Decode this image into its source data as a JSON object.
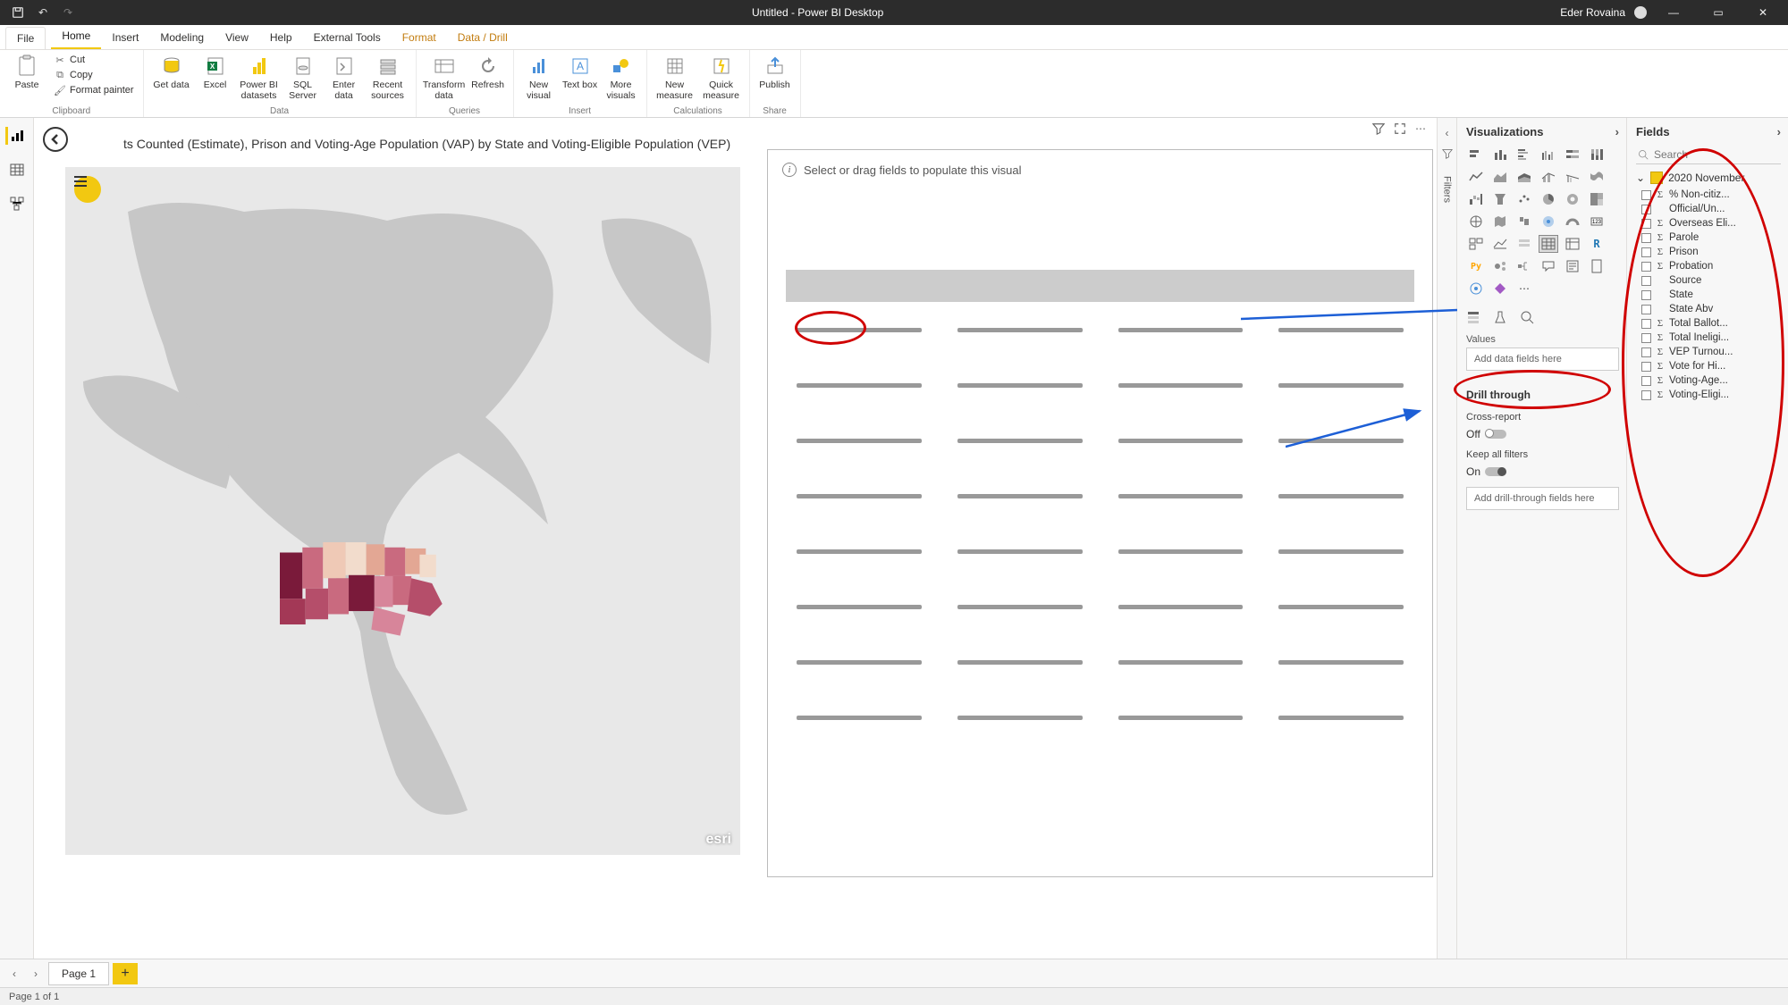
{
  "titlebar": {
    "title": "Untitled - Power BI Desktop",
    "user": "Eder Rovaina"
  },
  "tabs": {
    "file": "File",
    "items": [
      "Home",
      "Insert",
      "Modeling",
      "View",
      "Help",
      "External Tools",
      "Format",
      "Data / Drill"
    ],
    "active": "Home"
  },
  "ribbon": {
    "clipboard": {
      "paste": "Paste",
      "cut": "Cut",
      "copy": "Copy",
      "fmt": "Format painter",
      "label": "Clipboard"
    },
    "data": {
      "get": "Get data",
      "excel": "Excel",
      "pbi": "Power BI datasets",
      "sql": "SQL Server",
      "enter": "Enter data",
      "recent": "Recent sources",
      "label": "Data"
    },
    "queries": {
      "transform": "Transform data",
      "refresh": "Refresh",
      "label": "Queries"
    },
    "insert": {
      "visual": "New visual",
      "textbox": "Text box",
      "more": "More visuals",
      "label": "Insert"
    },
    "calc": {
      "measure": "New measure",
      "quick": "Quick measure",
      "label": "Calculations"
    },
    "share": {
      "publish": "Publish",
      "label": "Share"
    }
  },
  "canvas": {
    "viztitle": "ts Counted (Estimate), Prison and Voting-Age Population (VAP) by State and Voting-Eligible Population (VEP)",
    "hint": "Select or drag fields to populate this visual",
    "esri": "esri"
  },
  "filters": {
    "label": "Filters"
  },
  "vizpane": {
    "title": "Visualizations",
    "values_label": "Values",
    "values_placeholder": "Add data fields here",
    "drill": "Drill through",
    "cross": "Cross-report",
    "cross_state": "Off",
    "keep": "Keep all filters",
    "keep_state": "On",
    "drill_placeholder": "Add drill-through fields here"
  },
  "fieldspane": {
    "title": "Fields",
    "search": "Search",
    "table": "2020 November",
    "fields": [
      {
        "s": true,
        "n": "% Non-citiz..."
      },
      {
        "s": false,
        "n": "Official/Un..."
      },
      {
        "s": true,
        "n": "Overseas Eli..."
      },
      {
        "s": true,
        "n": "Parole"
      },
      {
        "s": true,
        "n": "Prison"
      },
      {
        "s": true,
        "n": "Probation"
      },
      {
        "s": false,
        "n": "Source"
      },
      {
        "s": false,
        "n": "State"
      },
      {
        "s": false,
        "n": "State Abv"
      },
      {
        "s": true,
        "n": "Total Ballot..."
      },
      {
        "s": true,
        "n": "Total Ineligi..."
      },
      {
        "s": true,
        "n": "VEP Turnou..."
      },
      {
        "s": true,
        "n": "Vote for Hi..."
      },
      {
        "s": true,
        "n": "Voting-Age..."
      },
      {
        "s": true,
        "n": "Voting-Eligi..."
      }
    ]
  },
  "pagetabs": {
    "page": "Page 1"
  },
  "status": {
    "text": "Page 1 of 1"
  },
  "chart_data": {
    "type": "table",
    "note": "empty placeholder table visual — no data fields bound yet",
    "columns": 4,
    "rows": 8
  }
}
